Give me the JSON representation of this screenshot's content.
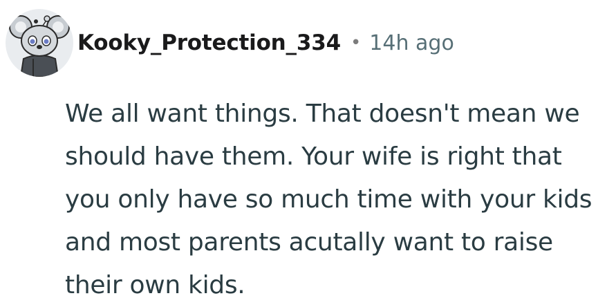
{
  "comment": {
    "author": "Kooky_Protection_334",
    "separator": "•",
    "timestamp": "14h ago",
    "body": "We all want things. That doesn't mean we should have them. Your wife is right that you only have so much time with your kids and most parents acutally want to raise their own kids.",
    "avatar_icon": "koala-snoo-avatar-icon"
  }
}
